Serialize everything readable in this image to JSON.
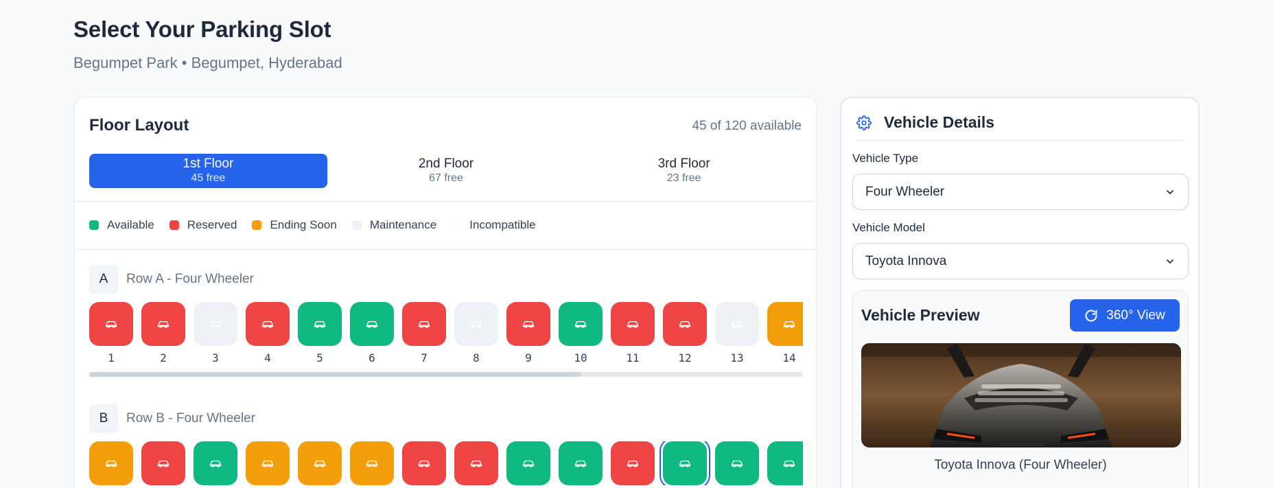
{
  "page": {
    "title": "Select Your Parking Slot",
    "subtitle": "Begumpet Park • Begumpet, Hyderabad"
  },
  "floor_layout": {
    "title": "Floor Layout",
    "availability": "45 of 120 available",
    "tabs": [
      {
        "name": "1st Floor",
        "free": "45 free",
        "active": true
      },
      {
        "name": "2nd Floor",
        "free": "67 free",
        "active": false
      },
      {
        "name": "3rd Floor",
        "free": "23 free",
        "active": false
      }
    ],
    "legend": [
      {
        "label": "Available",
        "color": "#10b981"
      },
      {
        "label": "Reserved",
        "color": "#ef4444"
      },
      {
        "label": "Ending Soon",
        "color": "#f59e0b"
      },
      {
        "label": "Maintenance",
        "color": "#eef2f7"
      },
      {
        "label": "Incompatible",
        "color": "#ffffff"
      }
    ],
    "rows": [
      {
        "letter": "A",
        "label": "Row A - Four Wheeler",
        "scroll_fraction": 0.69,
        "slots": [
          {
            "number": "1",
            "status": "reserved"
          },
          {
            "number": "2",
            "status": "reserved"
          },
          {
            "number": "3",
            "status": "maintenance"
          },
          {
            "number": "4",
            "status": "reserved"
          },
          {
            "number": "5",
            "status": "available"
          },
          {
            "number": "6",
            "status": "available"
          },
          {
            "number": "7",
            "status": "reserved"
          },
          {
            "number": "8",
            "status": "maintenance"
          },
          {
            "number": "9",
            "status": "reserved"
          },
          {
            "number": "10",
            "status": "available"
          },
          {
            "number": "11",
            "status": "reserved"
          },
          {
            "number": "12",
            "status": "reserved"
          },
          {
            "number": "13",
            "status": "maintenance"
          },
          {
            "number": "14",
            "status": "ending"
          }
        ]
      },
      {
        "letter": "B",
        "label": "Row B - Four Wheeler",
        "slots": [
          {
            "status": "ending"
          },
          {
            "status": "reserved"
          },
          {
            "status": "available"
          },
          {
            "status": "ending"
          },
          {
            "status": "ending"
          },
          {
            "status": "ending"
          },
          {
            "status": "reserved"
          },
          {
            "status": "reserved"
          },
          {
            "status": "available"
          },
          {
            "status": "available"
          },
          {
            "status": "reserved"
          },
          {
            "status": "available",
            "selected": true
          },
          {
            "status": "available"
          },
          {
            "status": "available"
          }
        ]
      }
    ]
  },
  "vehicle_details": {
    "title": "Vehicle Details",
    "icon": "gear-icon",
    "type_label": "Vehicle Type",
    "type_value": "Four Wheeler",
    "model_label": "Vehicle Model",
    "model_value": "Toyota Innova",
    "preview": {
      "title": "Vehicle Preview",
      "view_button": "360° View",
      "caption": "Toyota Innova (Four Wheeler)"
    }
  },
  "colors": {
    "accent": "#2563eb",
    "available": "#10b981",
    "reserved": "#ef4444",
    "ending": "#f59e0b",
    "maintenance": "#eef2f7"
  }
}
